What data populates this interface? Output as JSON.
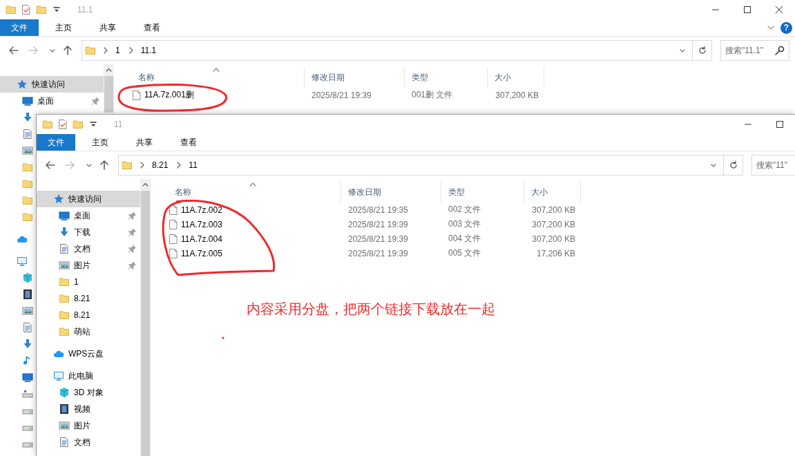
{
  "windows": [
    {
      "title": "11.1",
      "controls": [
        {
          "kind": "minimize"
        },
        {
          "kind": "maximize"
        },
        {
          "kind": "close"
        }
      ],
      "ribbon_tabs": [
        {
          "label": "文件",
          "selected": true
        },
        {
          "label": "主页",
          "selected": false
        },
        {
          "label": "共享",
          "selected": false
        },
        {
          "label": "查看",
          "selected": false
        }
      ],
      "help_button": {
        "label": "?"
      },
      "path": [
        "1",
        "11.1"
      ],
      "search": {
        "placeholder": "搜索\"11.1\""
      },
      "sidebar": [
        {
          "label": "快速访问",
          "kind": "star",
          "selected": true,
          "children": [
            {
              "label": "桌面",
              "kind": "desktop",
              "selected": false,
              "pinned": true
            },
            {
              "kind": "download",
              "selected": false,
              "pinned": false
            },
            {
              "kind": "doc",
              "selected": false,
              "pinned": false
            },
            {
              "kind": "picture",
              "selected": false,
              "pinned": false
            },
            {
              "kind": "folder",
              "selected": false,
              "pinned": false
            },
            {
              "kind": "folder",
              "selected": false,
              "pinned": false
            },
            {
              "kind": "folder",
              "selected": false,
              "pinned": false
            },
            {
              "kind": "folder",
              "selected": false,
              "pinned": false
            }
          ]
        },
        {
          "kind": "cloud",
          "selected": false
        },
        {
          "kind": "pc",
          "selected": false,
          "children": [
            {
              "kind": "cube",
              "selected": false
            },
            {
              "kind": "video",
              "selected": false
            },
            {
              "kind": "picture",
              "selected": false
            },
            {
              "kind": "doc",
              "selected": false
            },
            {
              "kind": "download",
              "selected": false
            },
            {
              "kind": "music",
              "selected": false
            },
            {
              "kind": "desktop",
              "selected": false
            },
            {
              "kind": "netdrive",
              "selected": false
            },
            {
              "kind": "drive",
              "selected": false
            },
            {
              "kind": "drive",
              "selected": false
            },
            {
              "kind": "drive",
              "selected": false
            }
          ]
        }
      ],
      "columns": [
        "名称",
        "修改日期",
        "类型",
        "大小"
      ],
      "files": [
        {
          "name": "11A.7z.001删",
          "date": "2025/8/21 19:39",
          "type": "001删 文件",
          "size": "307,200 KB"
        }
      ]
    },
    {
      "title": "11",
      "controls": [
        {
          "kind": "minimize"
        },
        {
          "kind": "maximize"
        }
      ],
      "ribbon_tabs": [
        {
          "label": "文件",
          "selected": true
        },
        {
          "label": "主页",
          "selected": false
        },
        {
          "label": "共享",
          "selected": false
        },
        {
          "label": "查看",
          "selected": false
        }
      ],
      "path": [
        "8.21",
        "11"
      ],
      "search": {
        "placeholder": "搜索\"11\""
      },
      "sidebar": [
        {
          "label": "快速访问",
          "kind": "star",
          "selected": true,
          "children": [
            {
              "label": "桌面",
              "kind": "desktop",
              "selected": false,
              "pinned": true
            },
            {
              "label": "下载",
              "kind": "download",
              "selected": false,
              "pinned": true
            },
            {
              "label": "文档",
              "kind": "doc",
              "selected": false,
              "pinned": true
            },
            {
              "label": "图片",
              "kind": "picture",
              "selected": false,
              "pinned": true
            },
            {
              "label": "1",
              "kind": "folder",
              "selected": false,
              "pinned": false
            },
            {
              "label": "8.21",
              "kind": "folder",
              "selected": false,
              "pinned": false
            },
            {
              "label": "8.21",
              "kind": "folder",
              "selected": false,
              "pinned": false
            },
            {
              "label": "萌站",
              "kind": "folder",
              "selected": false,
              "pinned": false
            }
          ]
        },
        {
          "label": "WPS云盘",
          "kind": "cloud",
          "selected": false
        },
        {
          "label": "此电脑",
          "kind": "pc",
          "selected": false,
          "children": [
            {
              "label": "3D 对象",
              "kind": "cube",
              "selected": false
            },
            {
              "label": "视频",
              "kind": "video",
              "selected": false
            },
            {
              "label": "图片",
              "kind": "picture",
              "selected": false
            },
            {
              "label": "文档",
              "kind": "doc",
              "selected": false
            }
          ]
        }
      ],
      "columns": [
        "名称",
        "修改日期",
        "类型",
        "大小"
      ],
      "files": [
        {
          "name": "11A.7z.002",
          "date": "2025/8/21 19:35",
          "type": "002 文件",
          "size": "307,200 KB"
        },
        {
          "name": "11A.7z.003",
          "date": "2025/8/21 19:39",
          "type": "003 文件",
          "size": "307,200 KB"
        },
        {
          "name": "11A.7z.004",
          "date": "2025/8/21 19:39",
          "type": "004 文件",
          "size": "307,200 KB"
        },
        {
          "name": "11A.7z.005",
          "date": "2025/8/21 19:39",
          "type": "005 文件",
          "size": "17,206 KB"
        }
      ]
    }
  ],
  "annotation": {
    "note": "内容采用分盘，把两个链接下载放在一起"
  }
}
